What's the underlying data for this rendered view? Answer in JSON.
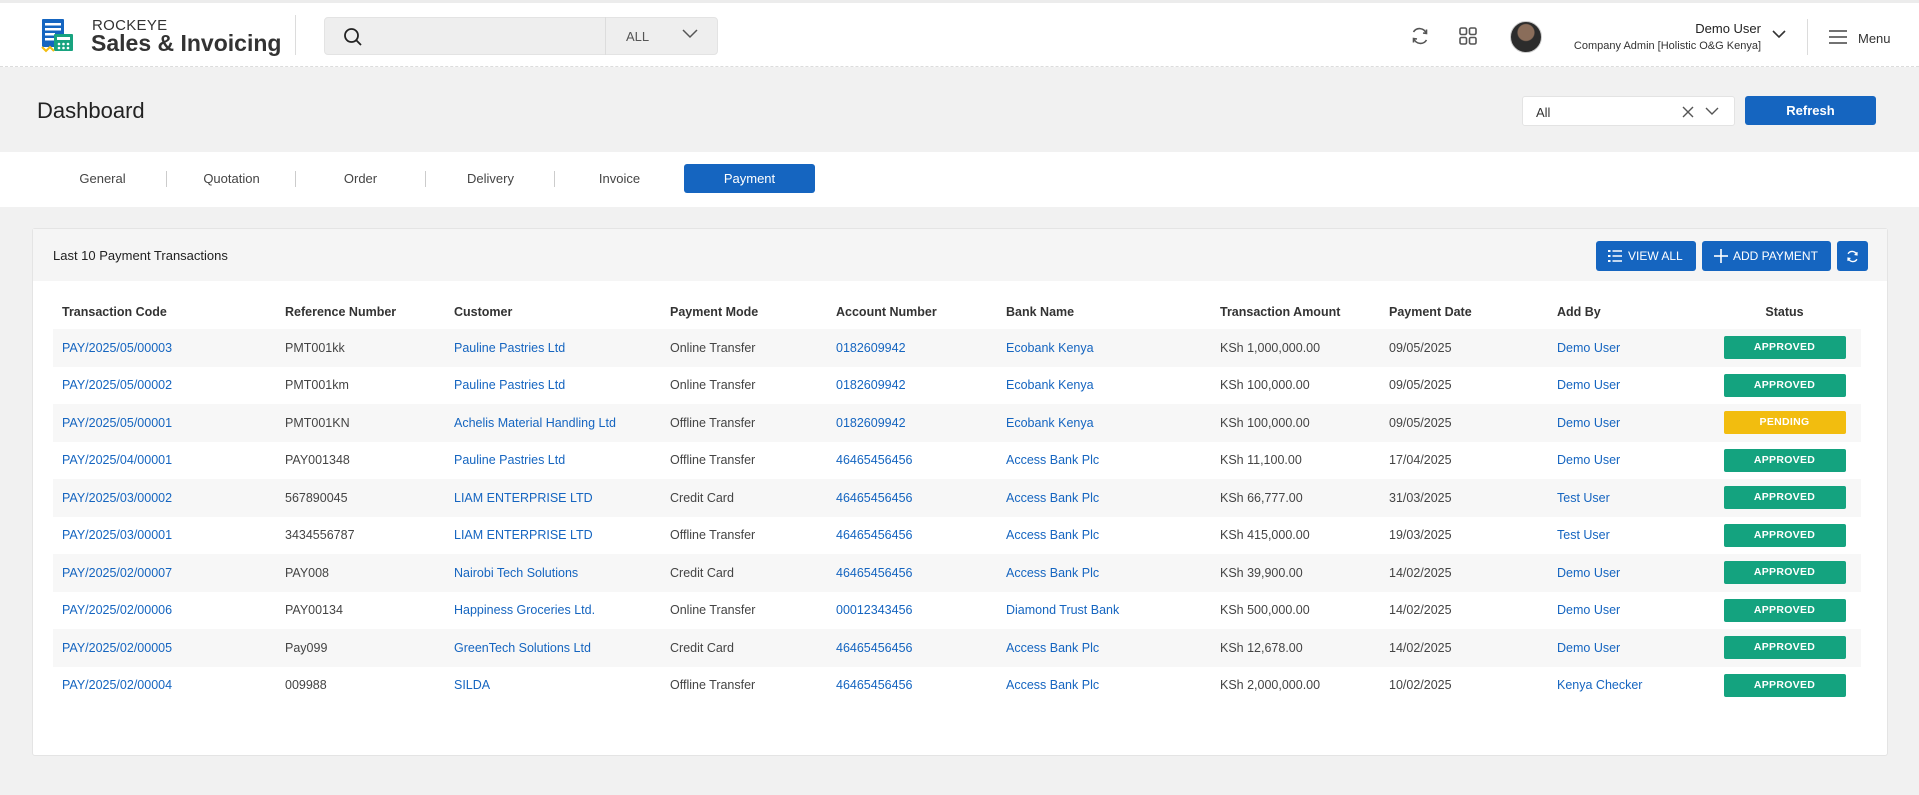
{
  "app": {
    "brand_small": "ROCKEYE",
    "brand_big": "Sales & Invoicing"
  },
  "search": {
    "placeholder": "",
    "value": "",
    "scope": "ALL"
  },
  "user": {
    "name": "Demo User",
    "role": "Company Admin [Holistic O&G Kenya]"
  },
  "menu": {
    "label": "Menu"
  },
  "page": {
    "title": "Dashboard"
  },
  "filter": {
    "value": "All",
    "refresh_label": "Refresh"
  },
  "tabs": [
    {
      "label": "General",
      "active": false
    },
    {
      "label": "Quotation",
      "active": false
    },
    {
      "label": "Order",
      "active": false
    },
    {
      "label": "Delivery",
      "active": false
    },
    {
      "label": "Invoice",
      "active": false
    },
    {
      "label": "Payment",
      "active": true
    }
  ],
  "card": {
    "title": "Last 10 Payment Transactions",
    "view_all_label": "VIEW ALL",
    "add_payment_label": "ADD PAYMENT"
  },
  "table": {
    "columns": [
      "Transaction Code",
      "Reference Number",
      "Customer",
      "Payment Mode",
      "Account Number",
      "Bank Name",
      "Transaction Amount",
      "Payment Date",
      "Add By",
      "Status"
    ],
    "rows": [
      {
        "code": "PAY/2025/05/00003",
        "ref": "PMT001kk",
        "customer": "Pauline Pastries Ltd",
        "mode": "Online Transfer",
        "account": "0182609942",
        "bank": "Ecobank Kenya",
        "amount": "KSh 1,000,000.00",
        "date": "09/05/2025",
        "by": "Demo User",
        "status": "APPROVED"
      },
      {
        "code": "PAY/2025/05/00002",
        "ref": "PMT001km",
        "customer": "Pauline Pastries Ltd",
        "mode": "Online Transfer",
        "account": "0182609942",
        "bank": "Ecobank Kenya",
        "amount": "KSh 100,000.00",
        "date": "09/05/2025",
        "by": "Demo User",
        "status": "APPROVED"
      },
      {
        "code": "PAY/2025/05/00001",
        "ref": "PMT001KN",
        "customer": "Achelis Material Handling Ltd",
        "mode": "Offline Transfer",
        "account": "0182609942",
        "bank": "Ecobank Kenya",
        "amount": "KSh 100,000.00",
        "date": "09/05/2025",
        "by": "Demo User",
        "status": "PENDING"
      },
      {
        "code": "PAY/2025/04/00001",
        "ref": "PAY001348",
        "customer": "Pauline Pastries Ltd",
        "mode": "Offline Transfer",
        "account": "46465456456",
        "bank": "Access Bank Plc",
        "amount": "KSh 11,100.00",
        "date": "17/04/2025",
        "by": "Demo User",
        "status": "APPROVED"
      },
      {
        "code": "PAY/2025/03/00002",
        "ref": "567890045",
        "customer": "LIAM ENTERPRISE LTD",
        "mode": "Credit Card",
        "account": "46465456456",
        "bank": "Access Bank Plc",
        "amount": "KSh 66,777.00",
        "date": "31/03/2025",
        "by": "Test User",
        "status": "APPROVED"
      },
      {
        "code": "PAY/2025/03/00001",
        "ref": "3434556787",
        "customer": "LIAM ENTERPRISE LTD",
        "mode": "Offline Transfer",
        "account": "46465456456",
        "bank": "Access Bank Plc",
        "amount": "KSh 415,000.00",
        "date": "19/03/2025",
        "by": "Test User",
        "status": "APPROVED"
      },
      {
        "code": "PAY/2025/02/00007",
        "ref": "PAY008",
        "customer": "Nairobi Tech Solutions",
        "mode": "Credit Card",
        "account": "46465456456",
        "bank": "Access Bank Plc",
        "amount": "KSh 39,900.00",
        "date": "14/02/2025",
        "by": "Demo User",
        "status": "APPROVED"
      },
      {
        "code": "PAY/2025/02/00006",
        "ref": "PAY00134",
        "customer": "Happiness Groceries Ltd.",
        "mode": "Online Transfer",
        "account": "00012343456",
        "bank": "Diamond Trust Bank",
        "amount": "KSh 500,000.00",
        "date": "14/02/2025",
        "by": "Demo User",
        "status": "APPROVED"
      },
      {
        "code": "PAY/2025/02/00005",
        "ref": "Pay099",
        "customer": "GreenTech Solutions Ltd",
        "mode": "Credit Card",
        "account": "46465456456",
        "bank": "Access Bank Plc",
        "amount": "KSh 12,678.00",
        "date": "14/02/2025",
        "by": "Demo User",
        "status": "APPROVED"
      },
      {
        "code": "PAY/2025/02/00004",
        "ref": "009988",
        "customer": "SILDA",
        "mode": "Offline Transfer",
        "account": "46465456456",
        "bank": "Access Bank Plc",
        "amount": "KSh 2,000,000.00",
        "date": "10/02/2025",
        "by": "Kenya Checker",
        "status": "APPROVED"
      }
    ]
  },
  "colors": {
    "primary": "#1565c0",
    "approved": "#14a37f",
    "pending": "#f2bd0f"
  },
  "icons": {
    "logo": "invoice-logo-icon",
    "search": "search-icon",
    "sync": "refresh-icon",
    "apps": "apps-grid-icon",
    "menu": "hamburger-icon"
  }
}
